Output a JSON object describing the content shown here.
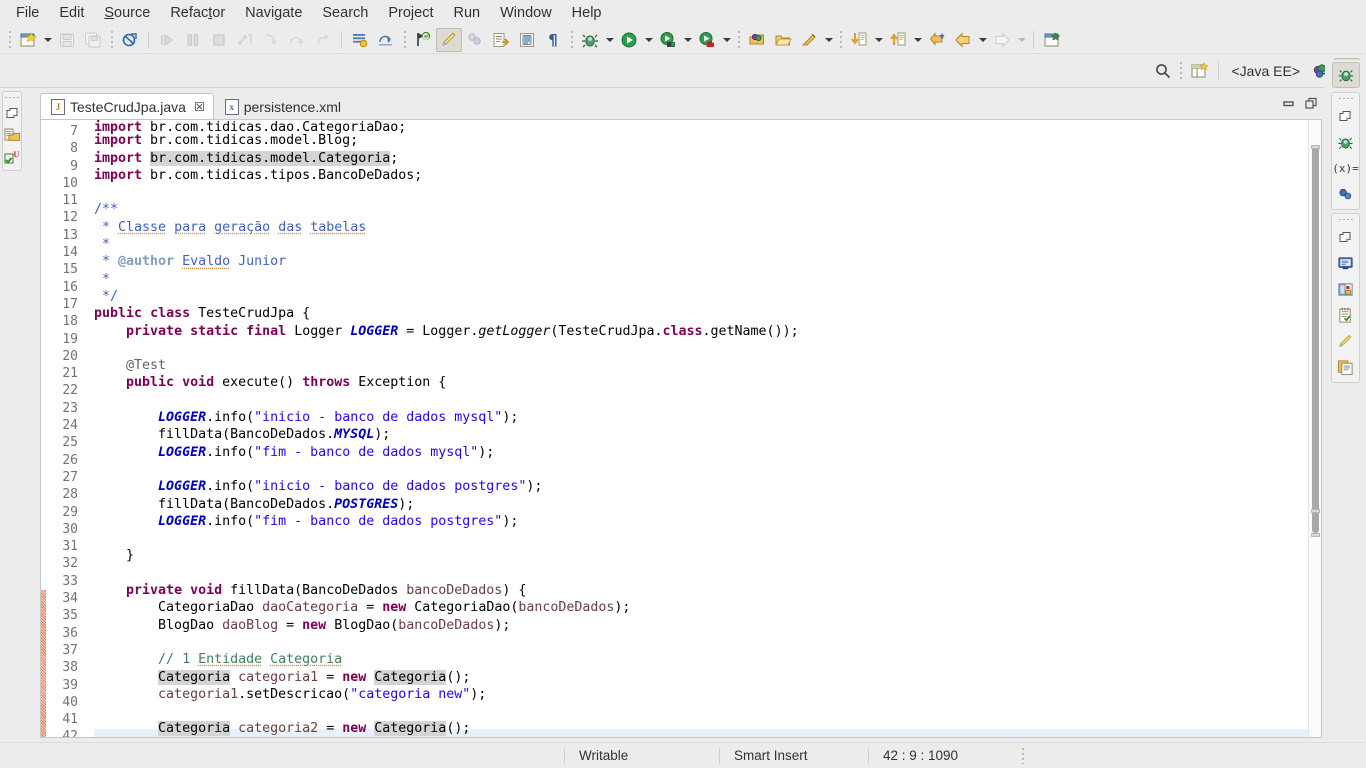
{
  "menu": {
    "items": [
      {
        "label": "File",
        "mnemonic_index": -1
      },
      {
        "label": "Edit",
        "mnemonic_index": -1
      },
      {
        "label": "Source",
        "mnemonic_index": 0
      },
      {
        "label": "Refactor",
        "mnemonic_index": 5
      },
      {
        "label": "Navigate",
        "mnemonic_index": -1
      },
      {
        "label": "Search",
        "mnemonic_index": -1
      },
      {
        "label": "Project",
        "mnemonic_index": -1
      },
      {
        "label": "Run",
        "mnemonic_index": -1
      },
      {
        "label": "Window",
        "mnemonic_index": -1
      },
      {
        "label": "Help",
        "mnemonic_index": -1
      }
    ]
  },
  "toolbar": {
    "groups": [
      {
        "name": "new-group",
        "buttons": [
          {
            "name": "new-wizard",
            "icon": "new-file-icon",
            "enabled": true,
            "dropdown": true
          },
          {
            "name": "save",
            "icon": "save-icon",
            "enabled": false,
            "dropdown": false
          },
          {
            "name": "save-all",
            "icon": "save-all-icon",
            "enabled": false,
            "dropdown": false
          }
        ]
      },
      {
        "name": "build-group",
        "buttons": [
          {
            "name": "build-all",
            "icon": "build-disabled-icon",
            "enabled": true,
            "dropdown": false
          }
        ]
      },
      {
        "name": "debug-control-group",
        "buttons": [
          {
            "name": "resume",
            "icon": "resume-icon",
            "enabled": false,
            "dropdown": false
          },
          {
            "name": "suspend",
            "icon": "suspend-icon",
            "enabled": false,
            "dropdown": false
          },
          {
            "name": "terminate",
            "icon": "terminate-icon",
            "enabled": false,
            "dropdown": false
          },
          {
            "name": "step-into-selection",
            "icon": "step-into-selection-icon",
            "enabled": false,
            "dropdown": false
          },
          {
            "name": "step-into",
            "icon": "step-into-icon",
            "enabled": false,
            "dropdown": false
          },
          {
            "name": "step-over",
            "icon": "step-over-icon",
            "enabled": false,
            "dropdown": false
          },
          {
            "name": "step-return",
            "icon": "step-return-icon",
            "enabled": false,
            "dropdown": false
          }
        ]
      },
      {
        "name": "view-group",
        "buttons": [
          {
            "name": "skip-all-breakpoints",
            "icon": "breakpoints-icon",
            "enabled": true,
            "dropdown": false
          },
          {
            "name": "drop-to-frame",
            "icon": "drop-to-frame-icon",
            "enabled": true,
            "dropdown": false
          }
        ]
      },
      {
        "name": "editor-group",
        "buttons": [
          {
            "name": "last-edit-location",
            "icon": "last-edit-icon",
            "enabled": true,
            "dropdown": false
          },
          {
            "name": "toggle-mark-occurrences",
            "icon": "mark-occurrences-icon",
            "enabled": true,
            "pressed": true,
            "dropdown": false
          },
          {
            "name": "toggle-breadcrumb",
            "icon": "breadcrumb-icon",
            "enabled": false,
            "dropdown": false
          },
          {
            "name": "open-task",
            "icon": "open-task-icon",
            "enabled": true,
            "dropdown": false
          },
          {
            "name": "toggle-block-selection",
            "icon": "block-selection-icon",
            "enabled": true,
            "dropdown": false
          },
          {
            "name": "show-whitespace",
            "icon": "pilcrow-icon",
            "enabled": true,
            "dropdown": false
          }
        ]
      },
      {
        "name": "launch-group",
        "buttons": [
          {
            "name": "debug",
            "icon": "debug-bug-icon",
            "enabled": true,
            "dropdown": true
          },
          {
            "name": "run",
            "icon": "run-green-icon",
            "enabled": true,
            "dropdown": true
          },
          {
            "name": "run-on-server",
            "icon": "run-server-icon",
            "enabled": true,
            "dropdown": true
          },
          {
            "name": "profile",
            "icon": "profile-icon",
            "enabled": true,
            "dropdown": true
          }
        ]
      },
      {
        "name": "resource-group",
        "buttons": [
          {
            "name": "new-java-package",
            "icon": "package-icon",
            "enabled": true,
            "dropdown": false
          },
          {
            "name": "open-type",
            "icon": "open-type-icon",
            "enabled": true,
            "dropdown": false
          },
          {
            "name": "new-java-class",
            "icon": "new-class-icon",
            "enabled": true,
            "dropdown": true
          }
        ]
      },
      {
        "name": "navigate-group",
        "buttons": [
          {
            "name": "next-annotation",
            "icon": "next-annotation-icon",
            "enabled": true,
            "dropdown": true
          },
          {
            "name": "previous-annotation",
            "icon": "previous-annotation-icon",
            "enabled": true,
            "dropdown": true
          },
          {
            "name": "last-edit-position",
            "icon": "last-edit-pos-icon",
            "enabled": true,
            "dropdown": false
          },
          {
            "name": "back",
            "icon": "back-arrow-icon",
            "enabled": true,
            "dropdown": true
          },
          {
            "name": "forward",
            "icon": "forward-arrow-icon",
            "enabled": false,
            "dropdown": true
          }
        ]
      },
      {
        "name": "misc-group",
        "buttons": [
          {
            "name": "new-window",
            "icon": "new-window-icon",
            "enabled": true,
            "dropdown": false
          }
        ]
      }
    ]
  },
  "perspective_bar": {
    "search_icon": "search-icon",
    "open-perspective_icon": "open-perspective-icon",
    "current_label": "<Java EE>",
    "perspectives": [
      {
        "name": "java-ee-perspective",
        "icon": "java-ee-icon",
        "active": false
      },
      {
        "name": "debug-perspective",
        "icon": "debug-perspective-icon",
        "active": true
      }
    ]
  },
  "left_sidebar": {
    "stacks": [
      {
        "name": "project-explorer-stack",
        "items": [
          {
            "name": "restore-icon",
            "label": "Restore"
          },
          {
            "name": "project-explorer-icon",
            "label": "Project Explorer"
          },
          {
            "name": "junit-view-icon",
            "label": "JUnit"
          }
        ]
      }
    ]
  },
  "right_sidebar": {
    "top_button": {
      "name": "debug-perspective-icon",
      "label": "Debug"
    },
    "stacks": [
      {
        "name": "debug-stack",
        "items": [
          {
            "name": "restore-icon",
            "label": "Restore"
          },
          {
            "name": "debug-view-icon",
            "label": "Debug"
          },
          {
            "name": "variables-view-icon",
            "label": "Variables"
          },
          {
            "name": "breakpoints-view-icon",
            "label": "Breakpoints"
          }
        ]
      },
      {
        "name": "outline-stack",
        "items": [
          {
            "name": "restore-icon",
            "label": "Restore"
          },
          {
            "name": "console-view-icon",
            "label": "Console"
          },
          {
            "name": "servers-view-icon",
            "label": "Servers"
          },
          {
            "name": "tasks-view-icon",
            "label": "Tasks"
          },
          {
            "name": "markers-view-icon",
            "label": "Markers"
          },
          {
            "name": "outline-view-icon",
            "label": "Outline"
          }
        ]
      }
    ]
  },
  "editor": {
    "tabs": [
      {
        "label": "TesteCrudJpa.java",
        "icon": "java-file-icon",
        "active": true,
        "closable": true,
        "close_glyph": "☒"
      },
      {
        "label": "persistence.xml",
        "icon": "xml-file-icon",
        "active": false,
        "closable": false
      }
    ],
    "controls": [
      {
        "name": "minimize-button",
        "glyph": "minimize"
      },
      {
        "name": "maximize-button",
        "glyph": "maximize"
      }
    ],
    "first_visible_line": 7,
    "current_line": 42,
    "changed_lines": {
      "from": 34,
      "to": 42
    },
    "folding_lines": [
      12,
      21,
      34
    ],
    "code_lines": [
      {
        "n": 7,
        "html": "<span class=\"k\">import</span> br.com.tidicas.dao.CategoriaDao;",
        "clipped": true
      },
      {
        "n": 8,
        "html": "<span class=\"k\">import</span> br.com.tidicas.model.Blog;"
      },
      {
        "n": 9,
        "html": "<span class=\"k\">import</span> <span class=\"occ\">br.com.tidicas.model.Categoria</span>;"
      },
      {
        "n": 10,
        "html": "<span class=\"k\">import</span> br.com.tidicas.tipos.BancoDeDados;"
      },
      {
        "n": 11,
        "html": ""
      },
      {
        "n": 12,
        "html": "<span class=\"jd\">/**</span>"
      },
      {
        "n": 13,
        "html": "<span class=\"jd\"> * <span class=\"sq\">Classe</span> <span class=\"sq\">para</span> <span class=\"sq\">geração</span> <span class=\"sq\">das</span> <span class=\"sq\">tabelas</span></span>"
      },
      {
        "n": 14,
        "html": "<span class=\"jd\"> *</span>"
      },
      {
        "n": 15,
        "html": "<span class=\"jd\"> * </span><span class=\"jk\">@author</span><span class=\"jd\"> <span class=\"sq\">Evaldo</span> Junior</span>"
      },
      {
        "n": 16,
        "html": "<span class=\"jd\"> *</span>"
      },
      {
        "n": 17,
        "html": "<span class=\"jd\"> */</span>"
      },
      {
        "n": 18,
        "html": "<span class=\"k\">public</span> <span class=\"k\">class</span> TesteCrudJpa {"
      },
      {
        "n": 19,
        "html": "    <span class=\"k\">private</span> <span class=\"k\">static</span> <span class=\"k\">final</span> Logger <span class=\"fs\">LOGGER</span> = Logger.<span class=\"mi\">getLogger</span>(TesteCrudJpa.<span class=\"k\">class</span>.getName());"
      },
      {
        "n": 20,
        "html": ""
      },
      {
        "n": 21,
        "html": "    <span class=\"an\">@Test</span>"
      },
      {
        "n": 22,
        "html": "    <span class=\"k\">public</span> <span class=\"k\">void</span> execute() <span class=\"k\">throws</span> Exception {"
      },
      {
        "n": 23,
        "html": ""
      },
      {
        "n": 24,
        "html": "        <span class=\"fs\">LOGGER</span>.info(<span class=\"s\">\"inicio - banco de dados mysql\"</span>);"
      },
      {
        "n": 25,
        "html": "        fillData(BancoDeDados.<span class=\"fs\">MYSQL</span>);"
      },
      {
        "n": 26,
        "html": "        <span class=\"fs\">LOGGER</span>.info(<span class=\"s\">\"fim - banco de dados mysql\"</span>);"
      },
      {
        "n": 27,
        "html": ""
      },
      {
        "n": 28,
        "html": "        <span class=\"fs\">LOGGER</span>.info(<span class=\"s\">\"inicio - banco de dados postgres\"</span>);"
      },
      {
        "n": 29,
        "html": "        fillData(BancoDeDados.<span class=\"fs\">POSTGRES</span>);"
      },
      {
        "n": 30,
        "html": "        <span class=\"fs\">LOGGER</span>.info(<span class=\"s\">\"fim - banco de dados postgres\"</span>);"
      },
      {
        "n": 31,
        "html": ""
      },
      {
        "n": 32,
        "html": "    }"
      },
      {
        "n": 33,
        "html": ""
      },
      {
        "n": 34,
        "html": "    <span class=\"k\">private</span> <span class=\"k\">void</span> fillData(BancoDeDados <span class=\"lv\">bancoDeDados</span>) {"
      },
      {
        "n": 35,
        "html": "        CategoriaDao <span class=\"lv\">daoCategoria</span> = <span class=\"k\">new</span> CategoriaDao(<span class=\"lv\">bancoDeDados</span>);"
      },
      {
        "n": 36,
        "html": "        BlogDao <span class=\"lv\">daoBlog</span> = <span class=\"k\">new</span> BlogDao(<span class=\"lv\">bancoDeDados</span>);"
      },
      {
        "n": 37,
        "html": ""
      },
      {
        "n": 38,
        "html": "        <span class=\"c\">// 1 <span class=\"sq\">Entidade</span> <span class=\"sq\">Categoria</span></span>"
      },
      {
        "n": 39,
        "html": "        <span class=\"occ\">Categoria</span> <span class=\"lv\">categoria1</span> = <span class=\"k\">new</span> <span class=\"occ\">Categoria</span>();"
      },
      {
        "n": 40,
        "html": "        <span class=\"lv\">categoria1</span>.setDescricao(<span class=\"s\">\"categoria new\"</span>);"
      },
      {
        "n": 41,
        "html": ""
      },
      {
        "n": 42,
        "html": "        <span class=\"occ\">Categoria</span> <span class=\"lv\">categoria2</span> = <span class=\"k\">new</span> <span class=\"occ\">Categoria</span>();"
      }
    ],
    "code_plain_lines": [
      "import br.com.tidicas.dao.CategoriaDao;",
      "import br.com.tidicas.model.Blog;",
      "import br.com.tidicas.model.Categoria;",
      "import br.com.tidicas.tipos.BancoDeDados;",
      "",
      "/**",
      " * Classe para geração das tabelas",
      " *",
      " * @author Evaldo Junior",
      " *",
      " */",
      "public class TesteCrudJpa {",
      "    private static final Logger LOGGER = Logger.getLogger(TesteCrudJpa.class.getName());",
      "",
      "    @Test",
      "    public void execute() throws Exception {",
      "",
      "        LOGGER.info(\"inicio - banco de dados mysql\");",
      "        fillData(BancoDeDados.MYSQL);",
      "        LOGGER.info(\"fim - banco de dados mysql\");",
      "",
      "        LOGGER.info(\"inicio - banco de dados postgres\");",
      "        fillData(BancoDeDados.POSTGRES);",
      "        LOGGER.info(\"fim - banco de dados postgres\");",
      "",
      "    }",
      "",
      "    private void fillData(BancoDeDados bancoDeDados) {",
      "        CategoriaDao daoCategoria = new CategoriaDao(bancoDeDados);",
      "        BlogDao daoBlog = new BlogDao(bancoDeDados);",
      "",
      "        // 1 Entidade Categoria",
      "        Categoria categoria1 = new Categoria();",
      "        categoria1.setDescricao(\"categoria new\");",
      "",
      "        Categoria categoria2 = new Categoria();"
    ],
    "scrollbar": {
      "thumb_top_pct": 4,
      "thumb_height_pct": 63
    },
    "overview_markers": [
      {
        "name": "occurrence-marker",
        "top_pct": 4
      },
      {
        "name": "occurrence-marker",
        "top_pct": 63
      },
      {
        "name": "occurrence-marker",
        "top_pct": 67
      }
    ]
  },
  "statusbar": {
    "cells": [
      {
        "name": "writable-status",
        "label": "Writable"
      },
      {
        "name": "insert-mode-status",
        "label": "Smart Insert"
      },
      {
        "name": "cursor-position-status",
        "label": "42 : 9 : 1090"
      }
    ]
  },
  "colors": {
    "chrome": "#ececec",
    "editor_bg": "#ffffff",
    "keyword": "#7f0055",
    "string": "#2a00ff",
    "comment": "#3f7f5f",
    "javadoc": "#3f5fbf",
    "javadoc_tag": "#7f9fbf",
    "annotation": "#646464",
    "static_field": "#0000c0",
    "local_var": "#6a3e3e",
    "occurrence_highlight": "#d4d4d4",
    "current_line": "#e8f0fe",
    "line_number": "#727272",
    "diff_marker": "#e07a5a",
    "spell_squiggle": "#d08b3c"
  }
}
